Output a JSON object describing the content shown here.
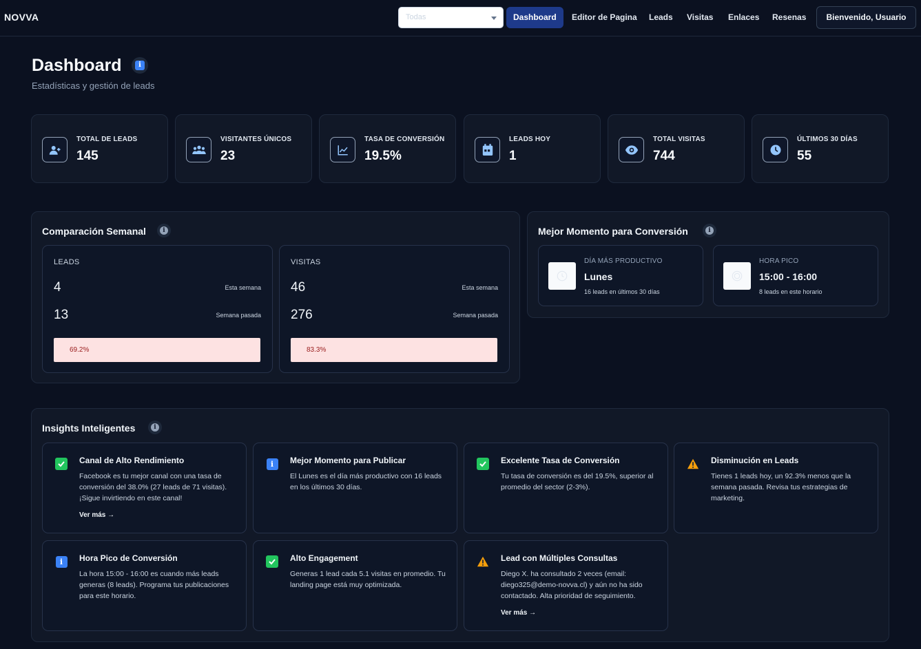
{
  "nav": {
    "brand": "NOVVA",
    "select_value": "Todas",
    "links": [
      "Dashboard",
      "Editor de Pagina",
      "Leads",
      "Visitas",
      "Enlaces",
      "Resenas"
    ],
    "welcome": "Bienvenido, Usuario"
  },
  "header": {
    "title": "Dashboard",
    "subtitle": "Estadísticas y gestión de leads",
    "info_glyph": "i"
  },
  "stats": [
    {
      "label": "TOTAL DE LEADS",
      "value": "145",
      "icon": "user-plus-icon"
    },
    {
      "label": "VISITANTES ÚNICOS",
      "value": "23",
      "icon": "users-icon"
    },
    {
      "label": "TASA DE CONVERSIÓN",
      "value": "19.5%",
      "icon": "line-chart-icon"
    },
    {
      "label": "LEADS HOY",
      "value": "1",
      "icon": "calendar-icon"
    },
    {
      "label": "TOTAL VISITAS",
      "value": "744",
      "icon": "eye-icon"
    },
    {
      "label": "ÚLTIMOS 30 DÍAS",
      "value": "55",
      "icon": "clock-icon"
    }
  ],
  "weekly": {
    "title": "Comparación Semanal",
    "cards": [
      {
        "heading": "LEADS",
        "this_week": "4",
        "this_week_label": "Esta semana",
        "last_week": "13",
        "last_week_label": "Semana pasada",
        "change": "69.2%"
      },
      {
        "heading": "VISITAS",
        "this_week": "46",
        "this_week_label": "Esta semana",
        "last_week": "276",
        "last_week_label": "Semana pasada",
        "change": "83.3%"
      }
    ]
  },
  "best_moment": {
    "title": "Mejor Momento para Conversión",
    "cards": [
      {
        "label": "DÍA MÁS PRODUCTIVO",
        "value": "Lunes",
        "sub": "16 leads en últimos 30 días"
      },
      {
        "label": "HORA PICO",
        "value": "15:00 - 16:00",
        "sub": "8 leads en este horario"
      }
    ]
  },
  "insights": {
    "title": "Insights Inteligentes",
    "items": [
      {
        "type": "success",
        "title": "Canal de Alto Rendimiento",
        "text": "Facebook es tu mejor canal con una tasa de conversión del 38.0% (27 leads de 71 visitas). ¡Sigue invirtiendo en este canal!",
        "more": "Ver más →"
      },
      {
        "type": "info",
        "title": "Mejor Momento para Publicar",
        "text": "El Lunes es el día más productivo con 16 leads en los últimos 30 días.",
        "more": ""
      },
      {
        "type": "success",
        "title": "Excelente Tasa de Conversión",
        "text": "Tu tasa de conversión es del 19.5%, superior al promedio del sector (2-3%).",
        "more": ""
      },
      {
        "type": "warning",
        "title": "Disminución en Leads",
        "text": "Tienes 1 leads hoy, un 92.3% menos que la semana pasada. Revisa tus estrategias de marketing.",
        "more": ""
      },
      {
        "type": "info",
        "title": "Hora Pico de Conversión",
        "text": "La hora 15:00 - 16:00 es cuando más leads generas (8 leads). Programa tus publicaciones para este horario.",
        "more": ""
      },
      {
        "type": "success",
        "title": "Alto Engagement",
        "text": "Generas 1 lead cada 5.1 visitas en promedio. Tu landing page está muy optimizada.",
        "more": ""
      },
      {
        "type": "warning",
        "title": "Lead con Múltiples Consultas",
        "text": "Diego X. ha consultado 2 veces (email: diego325@demo-novva.cl) y aún no ha sido contactado. Alta prioridad de seguimiento.",
        "more": "Ver más →"
      }
    ]
  },
  "colors": {
    "background": "#0b1120",
    "card": "#111827",
    "accent": "#1e3a8a",
    "success": "#22c55e",
    "info": "#3b82f6",
    "warning": "#f59e0b",
    "decline_bar": "#fde2e2"
  }
}
